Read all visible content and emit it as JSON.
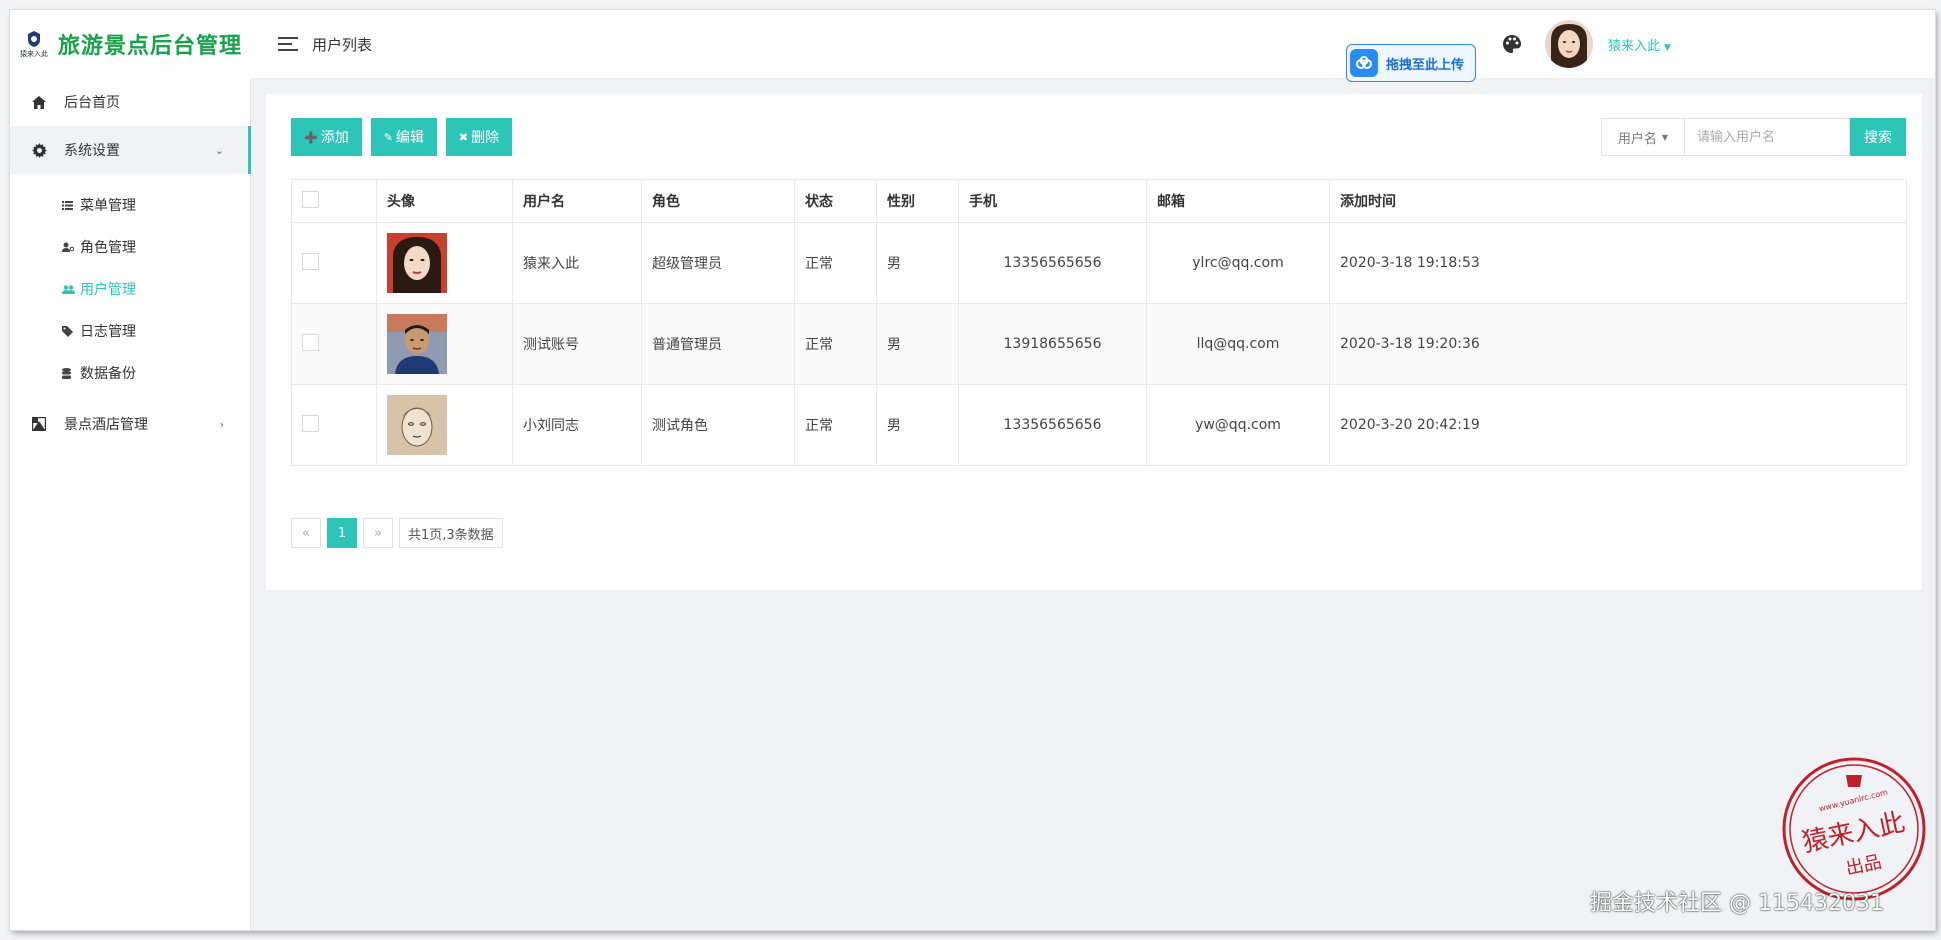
{
  "brand": {
    "title": "旅游景点后台管理",
    "logo_text": "猿来入此"
  },
  "sidebar": {
    "items": [
      {
        "label": "后台首页",
        "icon": "home-icon"
      },
      {
        "label": "系统设置",
        "icon": "gear-icon",
        "expanded": true
      },
      {
        "label": "景点酒店管理",
        "icon": "hotel-icon"
      }
    ],
    "sub_items": [
      {
        "label": "菜单管理",
        "icon": "list-icon"
      },
      {
        "label": "角色管理",
        "icon": "user-role-icon"
      },
      {
        "label": "用户管理",
        "icon": "users-icon",
        "active": true
      },
      {
        "label": "日志管理",
        "icon": "tag-icon"
      },
      {
        "label": "数据备份",
        "icon": "database-icon"
      }
    ]
  },
  "header": {
    "page_title": "用户列表",
    "upload_label": "拖拽至此上传",
    "user_name": "猿来入此"
  },
  "toolbar": {
    "add": "添加",
    "edit": "编辑",
    "delete": "删除"
  },
  "search": {
    "field": "用户名",
    "placeholder": "请输入用户名",
    "button": "搜索"
  },
  "table": {
    "headers": [
      "头像",
      "用户名",
      "角色",
      "状态",
      "性别",
      "手机",
      "邮箱",
      "添加时间"
    ],
    "rows": [
      {
        "username": "猿来入此",
        "role": "超级管理员",
        "status": "正常",
        "gender": "男",
        "phone": "13356565656",
        "email": "ylrc@qq.com",
        "created": "2020-3-18 19:18:53"
      },
      {
        "username": "测试账号",
        "role": "普通管理员",
        "status": "正常",
        "gender": "男",
        "phone": "13918655656",
        "email": "llq@qq.com",
        "created": "2020-3-18 19:20:36"
      },
      {
        "username": "小刘同志",
        "role": "测试角色",
        "status": "正常",
        "gender": "男",
        "phone": "13356565656",
        "email": "yw@qq.com",
        "created": "2020-3-20 20:42:19"
      }
    ]
  },
  "pager": {
    "prev": "«",
    "current": "1",
    "next": "»",
    "info": "共1页,3条数据"
  },
  "stamp": {
    "text": "猿来入此",
    "sub": "出品",
    "url": "www.yuanlrc.com"
  },
  "watermark": "掘金技术社区 @ 115432031",
  "colors": {
    "accent": "#2dc5b8",
    "brand": "#16a34a",
    "status": "#1ab394"
  }
}
